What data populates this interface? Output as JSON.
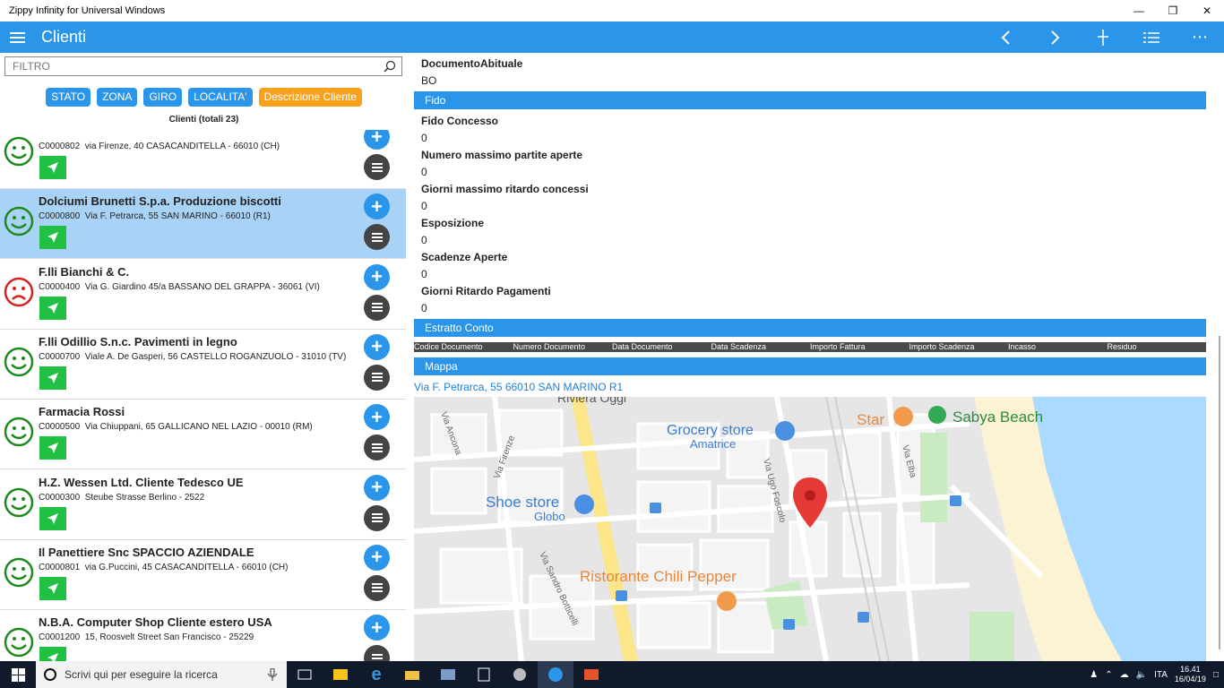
{
  "window": {
    "title": "Zippy Infinity for Universal Windows"
  },
  "appbar": {
    "title": "Clienti"
  },
  "filter": {
    "placeholder": "FILTRO"
  },
  "chips": [
    "STATO",
    "ZONA",
    "GIRO",
    "LOCALITA'",
    "Descrizione Cliente"
  ],
  "list": {
    "count_label": "Clienti (totali 23)",
    "clients": [
      {
        "name": "",
        "code": "C0000802",
        "address": "via Firenze, 40 CASACANDITELLA - 66010 (CH)",
        "mood": "happy",
        "selected": false
      },
      {
        "name": "Dolciumi Brunetti S.p.a. Produzione biscotti",
        "code": "C0000800",
        "address": "Via F. Petrarca, 55 SAN MARINO - 66010 (R1)",
        "mood": "happy",
        "selected": true
      },
      {
        "name": "F.lli Bianchi & C.",
        "code": "C0000400",
        "address": "Via G. Giardino 45/a BASSANO DEL GRAPPA - 36061 (VI)",
        "mood": "sad",
        "selected": false
      },
      {
        "name": "F.lli Odillio S.n.c. Pavimenti in legno",
        "code": "C0000700",
        "address": "Viale A. De Gasperi, 56 CASTELLO ROGANZUOLO - 31010 (TV)",
        "mood": "happy",
        "selected": false
      },
      {
        "name": "Farmacia Rossi",
        "code": "C0000500",
        "address": "Via Chiuppani, 65 GALLICANO NEL LAZIO - 00010 (RM)",
        "mood": "happy",
        "selected": false
      },
      {
        "name": "H.Z. Wessen Ltd. Cliente Tedesco UE",
        "code": "C0000300",
        "address": "Steube Strasse Berlino - 2522",
        "mood": "happy",
        "selected": false
      },
      {
        "name": "Il Panettiere Snc SPACCIO AZIENDALE",
        "code": "C0000801",
        "address": "via G.Puccini, 45 CASACANDITELLA - 66010 (CH)",
        "mood": "happy",
        "selected": false
      },
      {
        "name": "N.B.A. Computer Shop Cliente estero USA",
        "code": "C0001200",
        "address": "15, Roosvelt Street San Francisco - 25229",
        "mood": "happy",
        "selected": false
      }
    ]
  },
  "detail": {
    "documento_label": "DocumentoAbituale",
    "documento_value": "BO",
    "fido_header": "Fido",
    "fields": [
      {
        "label": "Fido Concesso",
        "value": "0"
      },
      {
        "label": "Numero massimo partite aperte",
        "value": "0"
      },
      {
        "label": "Giorni massimo ritardo concessi",
        "value": "0"
      },
      {
        "label": "Esposizione",
        "value": "0"
      },
      {
        "label": "Scadenze Aperte",
        "value": "0"
      },
      {
        "label": "Giorni Ritardo Pagamenti",
        "value": "0"
      }
    ],
    "estratto_header": "Estratto Conto",
    "estratto_columns": [
      "Codice Documento",
      "Numero Documento",
      "Data Documento",
      "Data Scadenza",
      "Importo Fattura",
      "Importo Scadenza",
      "Incasso",
      "Residuo"
    ],
    "mappa_header": "Mappa",
    "map_link": "Via F. Petrarca, 55 66010 SAN MARINO R1"
  },
  "map": {
    "labels": {
      "riviera": "Riviera Oggi",
      "grocery": "Grocery store",
      "amatrice": "Amatrice",
      "star": "Star",
      "sabya": "Sabya Beach",
      "shoe": "Shoe store",
      "globo": "Globo",
      "ristorante": "Ristorante Chili Pepper",
      "via_ancona": "Via Ancona",
      "via_firenze": "Via Firenze",
      "via_ugo": "Via Ugo Foscolo",
      "via_elba": "Via Elba",
      "via_sandro": "Via Sandro Botticelli"
    }
  },
  "taskbar": {
    "search_placeholder": "Scrivi qui per eseguire la ricerca",
    "lang": "ITA",
    "time": "16.41",
    "date": "16/04/19"
  },
  "colors": {
    "accent": "#2b95e9",
    "selected_row": "#a9d3f6",
    "nav_green": "#21c043",
    "orange_chip": "#f6a21d",
    "happy": "#1e8a1e",
    "sad": "#d42222"
  }
}
